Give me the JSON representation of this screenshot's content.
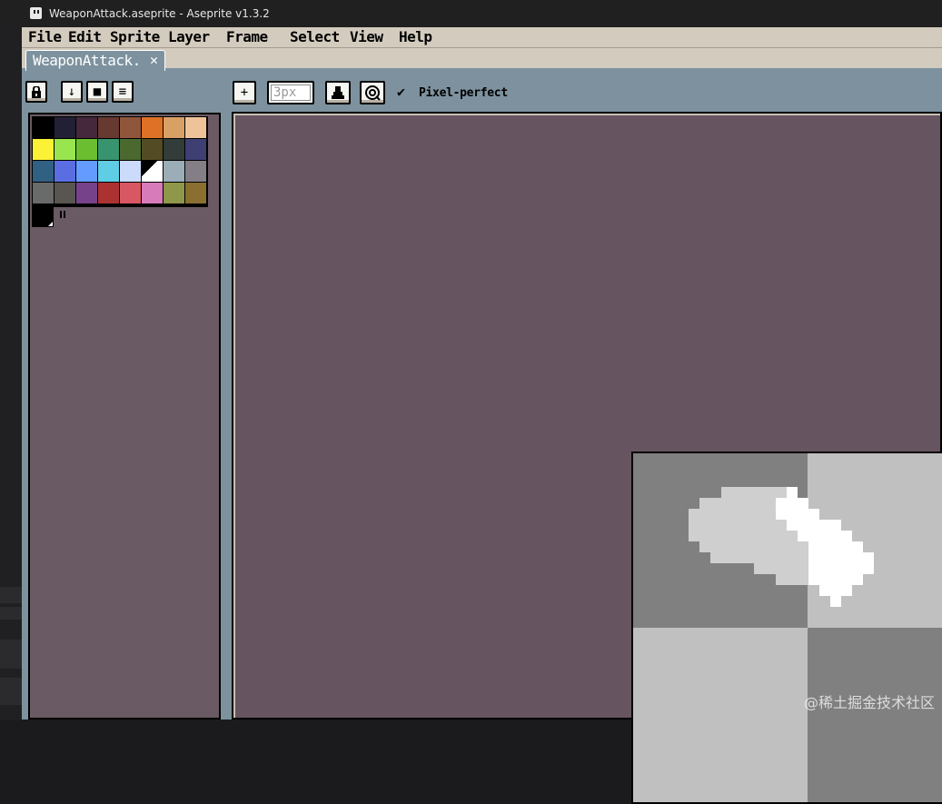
{
  "window": {
    "title": "WeaponAttack.aseprite - Aseprite v1.3.2",
    "icon": "aseprite-logo-icon"
  },
  "menu": [
    {
      "label": "File"
    },
    {
      "label": "Edit"
    },
    {
      "label": "Sprite"
    },
    {
      "label": "Layer"
    },
    {
      "label": "Frame"
    },
    {
      "label": "Select"
    },
    {
      "label": "View"
    },
    {
      "label": "Help"
    }
  ],
  "tab": {
    "label": "WeaponAttack.",
    "close": "✕"
  },
  "toolbar": {
    "lock_icon": "lock-icon",
    "segmented": [
      {
        "glyph": "↓",
        "icon": "arrow-down-icon"
      },
      {
        "glyph": "■",
        "icon": "square-icon"
      },
      {
        "glyph": "≡",
        "icon": "menu-icon"
      }
    ],
    "brush_type": "+",
    "brush_size_value": "3px",
    "ink_icon": "ink-bucket-icon",
    "dynamics_icon": "dynamics-icon",
    "pixel_perfect_check": "✔",
    "pixel_perfect_label": "Pixel-perfect"
  },
  "palette": [
    "#000000",
    "#222034",
    "#45283c",
    "#663931",
    "#8f563b",
    "#df7126",
    "#d9a066",
    "#eec39a",
    "#fbf236",
    "#99e550",
    "#6abe30",
    "#37946e",
    "#4b692f",
    "#524b24",
    "#323c39",
    "#3f3f74",
    "#306082",
    "#5b6ee1",
    "#639bff",
    "#5fcde4",
    "#cbdbfc",
    "#ffffff",
    "#9badb7",
    "#847e87",
    "#696a6a",
    "#595652",
    "#76428a",
    "#ac3232",
    "#d95763",
    "#d77bba",
    "#8f974a",
    "#8a6f30"
  ],
  "colors": {
    "foreground": "#000000",
    "editor_bg": "#665560",
    "panel_bg": "#7d929e",
    "checker_dark": "#808080",
    "checker_light": "#c0c0c0"
  },
  "watermark": "@稀土掘金技术社区"
}
